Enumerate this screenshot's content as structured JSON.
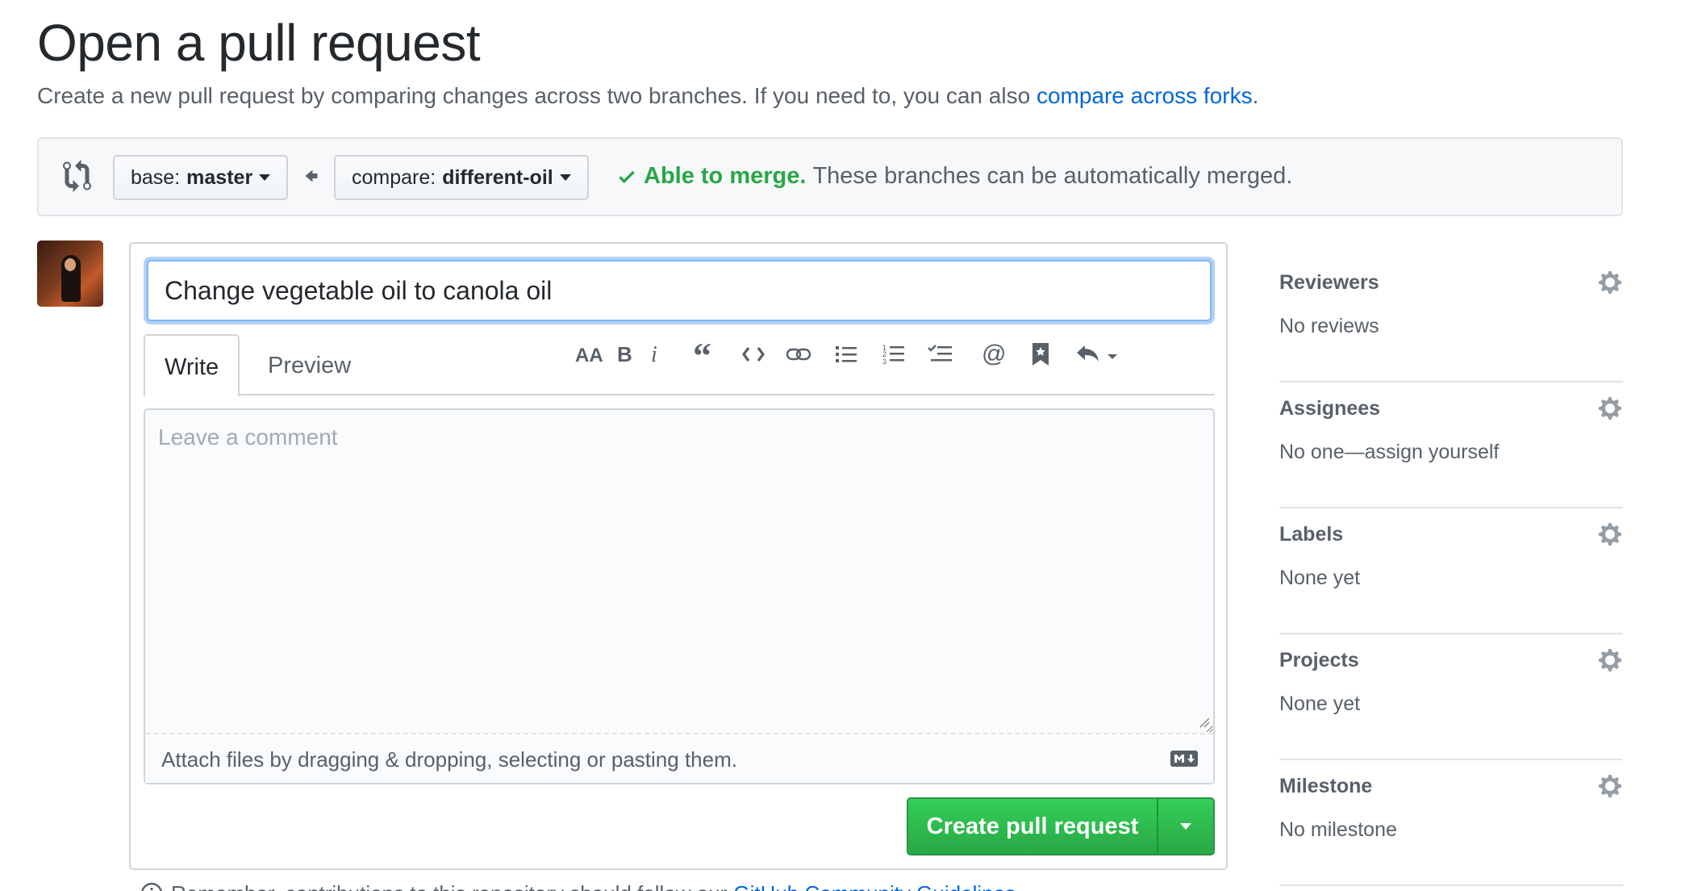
{
  "header": {
    "title": "Open a pull request",
    "subtitle_text": "Create a new pull request by comparing changes across two branches. If you need to, you can also",
    "subtitle_link": "compare across forks",
    "subtitle_end": "."
  },
  "compare": {
    "base_prefix": "base:",
    "base_branch": "master",
    "compare_prefix": "compare:",
    "compare_branch": "different-oil",
    "merge_ok": "Able to merge.",
    "merge_text": "These branches can be automatically merged."
  },
  "editor": {
    "title_value": "Change vegetable oil to canola oil",
    "tab_write": "Write",
    "tab_preview": "Preview",
    "comment_placeholder": "Leave a comment",
    "attach_hint": "Attach files by dragging & dropping, selecting or pasting them.",
    "submit_label": "Create pull request"
  },
  "toolbar_icons": [
    "header-icon",
    "bold-icon",
    "italic-icon",
    "quote-icon",
    "code-icon",
    "link-icon",
    "bullet-list-icon",
    "numbered-list-icon",
    "task-list-icon",
    "mention-icon",
    "saved-reply-icon",
    "reply-icon"
  ],
  "footnote": {
    "text": "Remember, contributions to this repository should follow our",
    "link": "GitHub Community Guidelines",
    "end": "."
  },
  "sidebar": {
    "sections": [
      {
        "heading": "Reviewers",
        "value": "No reviews"
      },
      {
        "heading": "Assignees",
        "value": "No one—assign yourself"
      },
      {
        "heading": "Labels",
        "value": "None yet"
      },
      {
        "heading": "Projects",
        "value": "None yet"
      },
      {
        "heading": "Milestone",
        "value": "No milestone"
      }
    ]
  },
  "colors": {
    "link": "#0366d6",
    "success": "#28a745",
    "text_muted": "#586069",
    "border": "#e1e4e8"
  }
}
